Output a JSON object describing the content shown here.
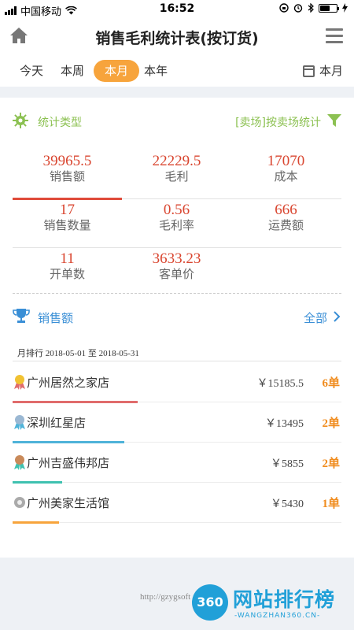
{
  "status_bar": {
    "carrier": "中国移动",
    "time": "16:52"
  },
  "header": {
    "title": "销售毛利统计表(按订货)",
    "home_icon": "home-icon",
    "menu_icon": "menu-icon"
  },
  "period_tabs": {
    "items": [
      {
        "label": "今天",
        "active": false
      },
      {
        "label": "本周",
        "active": false
      },
      {
        "label": "本月",
        "active": true
      },
      {
        "label": "本年",
        "active": false
      }
    ],
    "picker_label": "本月"
  },
  "stat_type": {
    "label": "统计类型",
    "filter_text": "[卖场]按卖场统计"
  },
  "stats": [
    {
      "value": "39965.5",
      "label": "销售额"
    },
    {
      "value": "22229.5",
      "label": "毛利"
    },
    {
      "value": "17070",
      "label": "成本"
    },
    {
      "value": "17",
      "label": "销售数量"
    },
    {
      "value": "0.56",
      "label": "毛利率"
    },
    {
      "value": "666",
      "label": "运费额"
    },
    {
      "value": "11",
      "label": "开单数"
    },
    {
      "value": "3633.23",
      "label": "客单价"
    }
  ],
  "ranking": {
    "title": "销售额",
    "all_label": "全部",
    "period_text": "月排行 2018-05-01 至 2018-05-31",
    "items": [
      {
        "name": "广州居然之家店",
        "amount": "￥15185.5",
        "count": "6单",
        "bar_fraction": 0.38,
        "bar_color": "#e06c6c",
        "medal_color": "#f1c232"
      },
      {
        "name": "深圳红星店",
        "amount": "￥13495",
        "count": "2单",
        "bar_fraction": 0.34,
        "bar_color": "#4fb3d9",
        "medal_color": "#9bb8d3"
      },
      {
        "name": "广州吉盛伟邦店",
        "amount": "￥5855",
        "count": "2单",
        "bar_fraction": 0.15,
        "bar_color": "#3fc1b0",
        "medal_color": "#c98a5a"
      },
      {
        "name": "广州美家生活馆",
        "amount": "￥5430",
        "count": "1单",
        "bar_fraction": 0.14,
        "bar_color": "#f7a43c",
        "medal_color": "#aaaaaa"
      }
    ]
  },
  "footer": {
    "url": "http://gzygsoft",
    "watermark_badge": "360",
    "watermark_name": "网站排行榜",
    "watermark_sub": "-WANGZHAN360.CN-"
  },
  "colors": {
    "accent_orange": "#f7a43c",
    "stat_red": "#d9452f",
    "link_blue": "#3a8fd6",
    "green": "#8cc152"
  }
}
